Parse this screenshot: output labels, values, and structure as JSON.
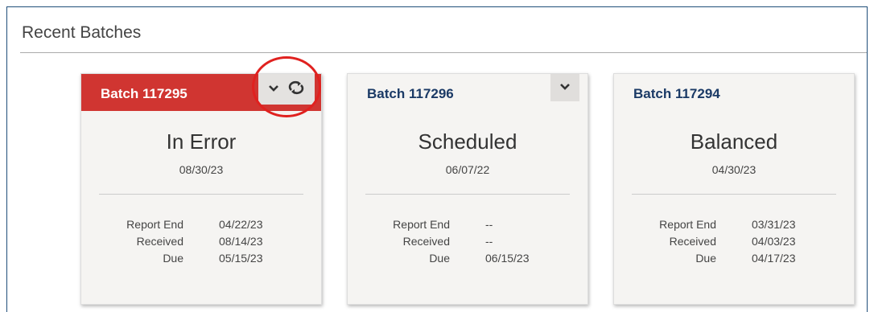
{
  "panel": {
    "title": "Recent Batches"
  },
  "cards": [
    {
      "title": "Batch 117295",
      "status": "In Error",
      "status_date": "08/30/23",
      "report_end_label": "Report End",
      "report_end": "04/22/23",
      "received_label": "Received",
      "received": "08/14/23",
      "due_label": "Due",
      "due": "05/15/23",
      "header_color": "#d03531"
    },
    {
      "title": "Batch 117296",
      "status": "Scheduled",
      "status_date": "06/07/22",
      "report_end_label": "Report End",
      "report_end": "--",
      "received_label": "Received",
      "received": "--",
      "due_label": "Due",
      "due": "06/15/23"
    },
    {
      "title": "Batch 117294",
      "status": "Balanced",
      "status_date": "04/30/23",
      "report_end_label": "Report End",
      "report_end": "03/31/23",
      "received_label": "Received",
      "received": "04/03/23",
      "due_label": "Due",
      "due": "04/17/23"
    }
  ],
  "icons": {
    "expand": "chevron-down-icon",
    "retry": "refresh-icon"
  },
  "annotation": {
    "color": "#e0211f"
  }
}
